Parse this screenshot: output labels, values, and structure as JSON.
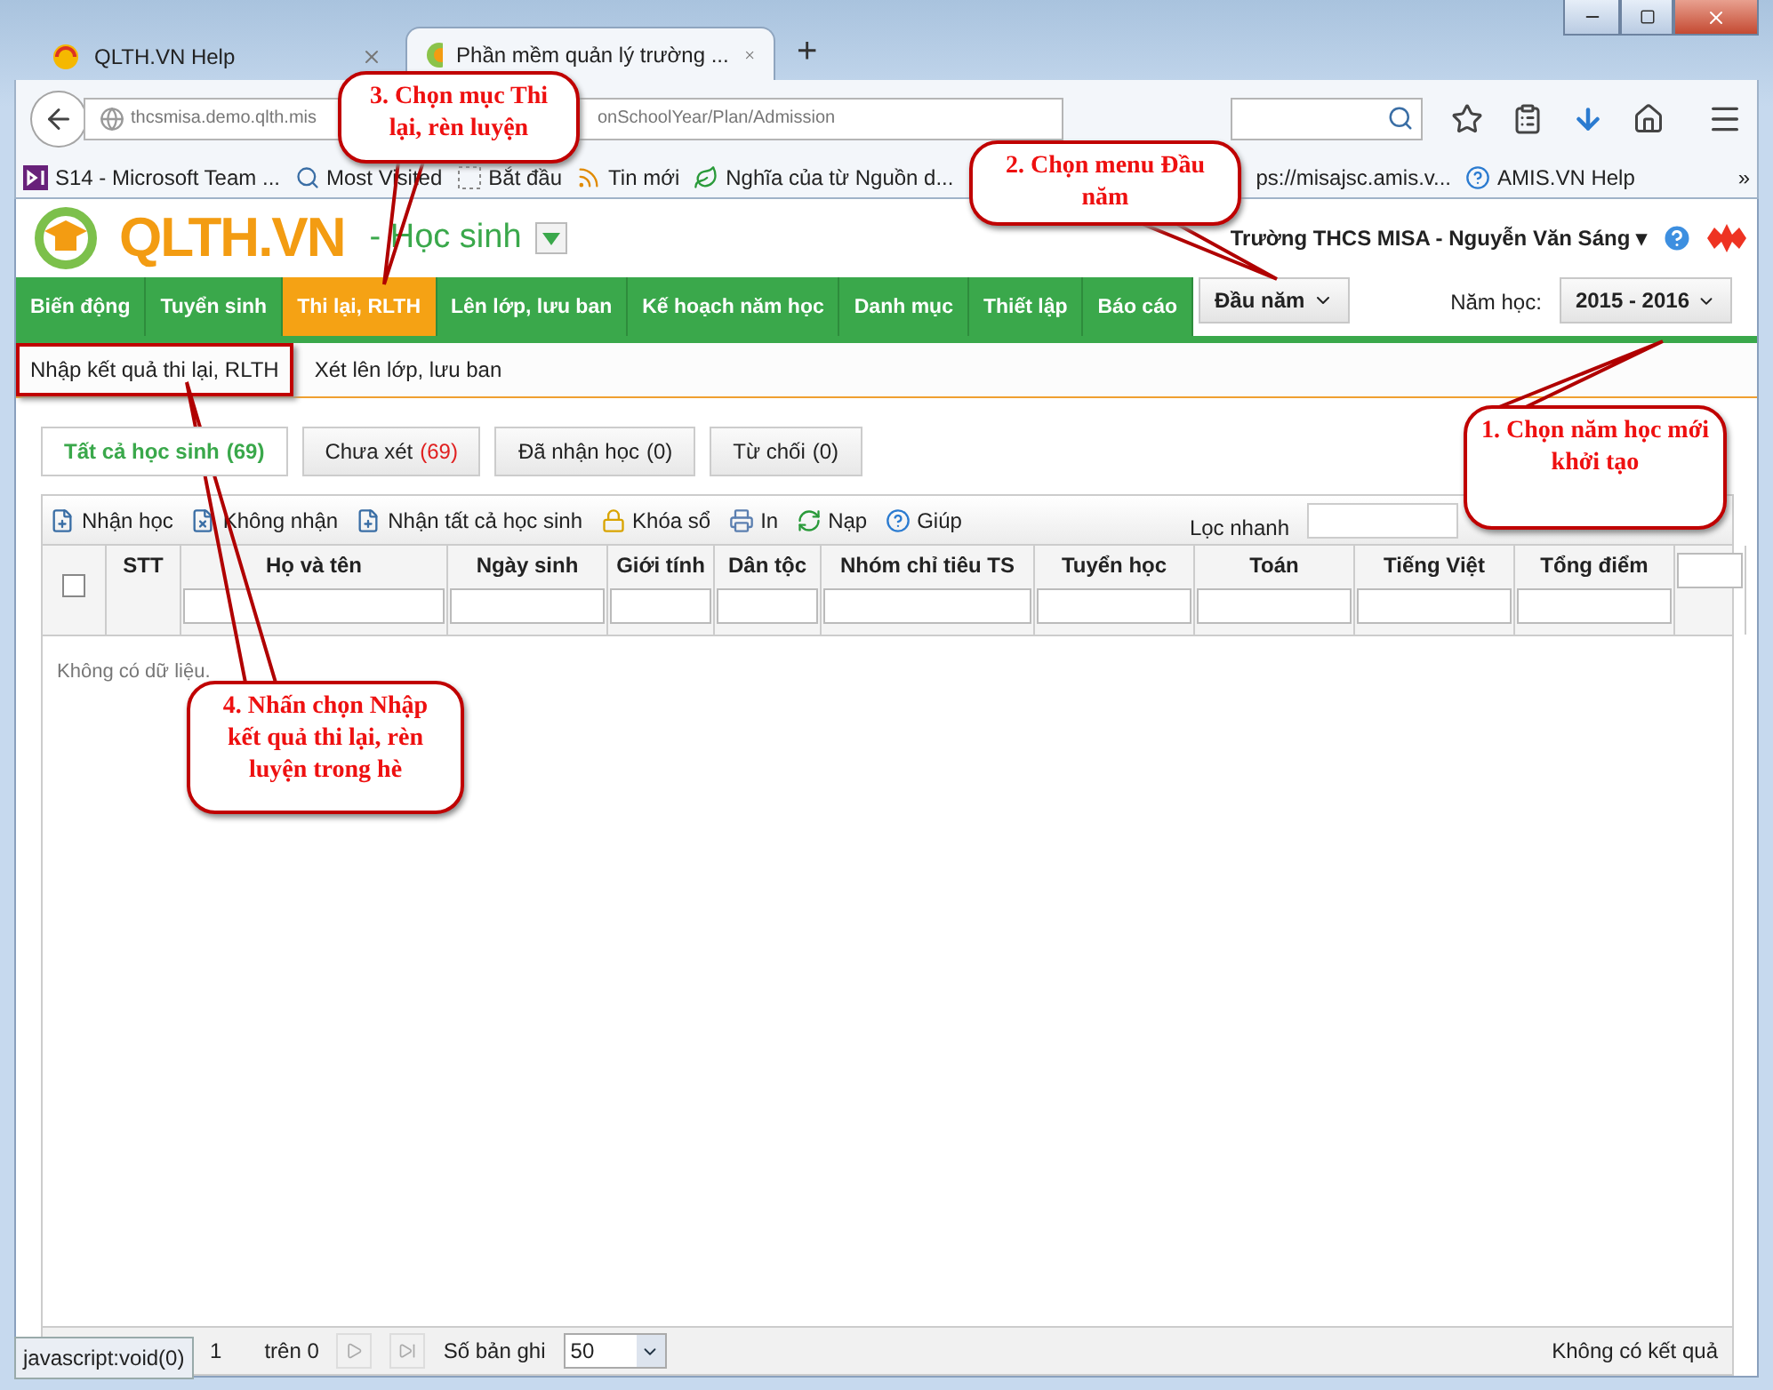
{
  "browser": {
    "tabs": [
      {
        "title": "QLTH.VN Help",
        "selected": false
      },
      {
        "title": "Phần mềm quản lý trường ...",
        "selected": true
      }
    ],
    "new_tab": "+",
    "address": {
      "url_start": "thcsmisa.demo.qlth.mis",
      "url_end": "onSchoolYear/Plan/Admission"
    },
    "bookmarks": [
      {
        "label": "S14 - Microsoft Team ..."
      },
      {
        "label": "Most Visited"
      },
      {
        "label": "Bắt đầu"
      },
      {
        "label": "Tin mới"
      },
      {
        "label": "Nghĩa của từ Nguồn d..."
      },
      {
        "label": "ps://misajsc.amis.v..."
      },
      {
        "label": "AMIS.VN Help"
      }
    ],
    "bookmarks_more": "»"
  },
  "app": {
    "logo": "QLTH.VN",
    "module": "- Học sinh",
    "user": "Trường THCS MISA - Nguyễn Văn Sáng",
    "user_caret": "▾",
    "menu": [
      {
        "label": "Biến động",
        "selected": false
      },
      {
        "label": "Tuyển sinh",
        "selected": false
      },
      {
        "label": "Thi lại, RLTH",
        "selected": true
      },
      {
        "label": "Lên lớp, lưu ban",
        "selected": false
      },
      {
        "label": "Kế hoạch năm học",
        "selected": false
      },
      {
        "label": "Danh mục",
        "selected": false
      },
      {
        "label": "Thiết lập",
        "selected": false
      },
      {
        "label": "Báo cáo",
        "selected": false
      }
    ],
    "period_menu": "Đầu năm",
    "year_label": "Năm học:",
    "year": "2015 - 2016",
    "submenu": [
      {
        "label": "Nhập kết quả thi lại, RLTH",
        "highlighted": true
      },
      {
        "label": "Xét lên lớp, lưu ban",
        "highlighted": false
      }
    ],
    "filter_tabs": [
      {
        "label": "Tất cả học sinh",
        "count": "(69)",
        "selected": true,
        "count_alert": false
      },
      {
        "label": "Chưa xét",
        "count": "(69)",
        "selected": false,
        "count_alert": true
      },
      {
        "label": "Đã nhận học",
        "count": "(0)",
        "selected": false,
        "count_alert": false
      },
      {
        "label": "Từ chối",
        "count": "(0)",
        "selected": false,
        "count_alert": false
      }
    ],
    "toolbar": [
      {
        "label": "Nhận học"
      },
      {
        "label": "Không nhận"
      },
      {
        "label": "Nhận tất cả học sinh"
      },
      {
        "label": "Khóa sổ"
      },
      {
        "label": "In"
      },
      {
        "label": "Nạp"
      },
      {
        "label": "Giúp"
      }
    ],
    "quick_filter": "Lọc nhanh",
    "table": {
      "select_all": {
        "checked": false
      },
      "columns": [
        {
          "label": "STT"
        },
        {
          "label": "Họ và tên"
        },
        {
          "label": "Ngày sinh"
        },
        {
          "label": "Giới tính"
        },
        {
          "label": "Dân tộc"
        },
        {
          "label": "Nhóm chỉ tiêu TS"
        },
        {
          "label": "Tuyển học"
        },
        {
          "label": "Toán"
        },
        {
          "label": "Tiếng Việt"
        },
        {
          "label": "Tổng điểm"
        }
      ],
      "empty": "Không có dữ liệu."
    },
    "pager": {
      "page": "1",
      "of": "trên 0",
      "page_size_label": "Số bản ghi",
      "page_size": "50",
      "result": "Không có kết quả"
    }
  },
  "status_link": "javascript:void(0)",
  "callouts": [
    {
      "text": "1. Chọn năm học mới khởi tạo"
    },
    {
      "text": "2. Chọn menu Đầu năm"
    },
    {
      "text": "3. Chọn mục Thi lại, rèn luyện"
    },
    {
      "text": "4. Nhấn chọn Nhập kết quả thi lại, rèn luyện trong hè"
    }
  ]
}
